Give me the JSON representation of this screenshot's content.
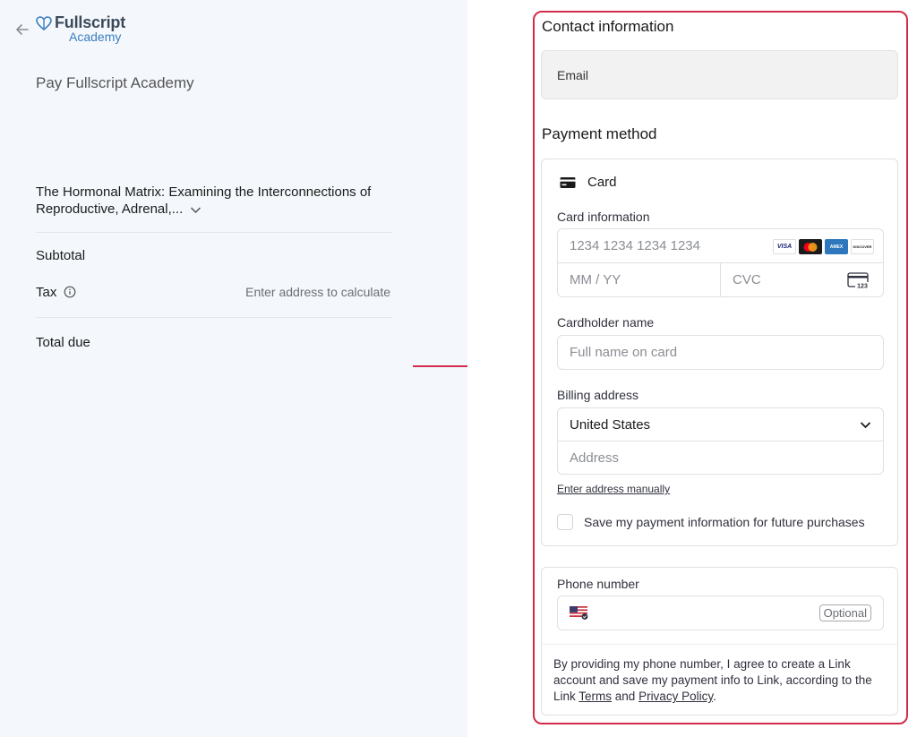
{
  "brand": {
    "name": "Fullscript",
    "sub": "Academy"
  },
  "summary": {
    "title": "Pay Fullscript Academy",
    "product_name": "The Hormonal Matrix: Examining the Interconnections of Reproductive, Adrenal,...",
    "subtotal_label": "Subtotal",
    "tax_label": "Tax",
    "tax_value": "Enter address to calculate",
    "total_label": "Total due"
  },
  "contact": {
    "heading": "Contact information",
    "email_label": "Email"
  },
  "payment": {
    "heading": "Payment method",
    "card_tab_label": "Card",
    "card_info_label": "Card information",
    "card_number_placeholder": "1234 1234 1234 1234",
    "expiry_placeholder": "MM / YY",
    "cvc_placeholder": "CVC",
    "cvc_icon_text": "123",
    "card_brands": [
      "VISA",
      "mastercard",
      "AMEX",
      "DISCOVER"
    ],
    "cardholder_label": "Cardholder name",
    "cardholder_placeholder": "Full name on card",
    "billing_label": "Billing address",
    "country_value": "United States",
    "address_placeholder": "Address",
    "manual_link": "Enter address manually",
    "save_label": "Save my payment information for future purchases",
    "save_checked": false
  },
  "phone": {
    "label": "Phone number",
    "optional_badge": "Optional",
    "legal_prefix": "By providing my phone number, I agree to create a Link account and save my payment info to Link, according to the Link ",
    "terms_link": "Terms",
    "and_text": " and ",
    "privacy_link": "Privacy Policy",
    "legal_suffix": "."
  },
  "colors": {
    "accent_highlight": "#d12c4c",
    "left_bg": "#f4f8fc",
    "brand_blue": "#3a7ec0"
  }
}
